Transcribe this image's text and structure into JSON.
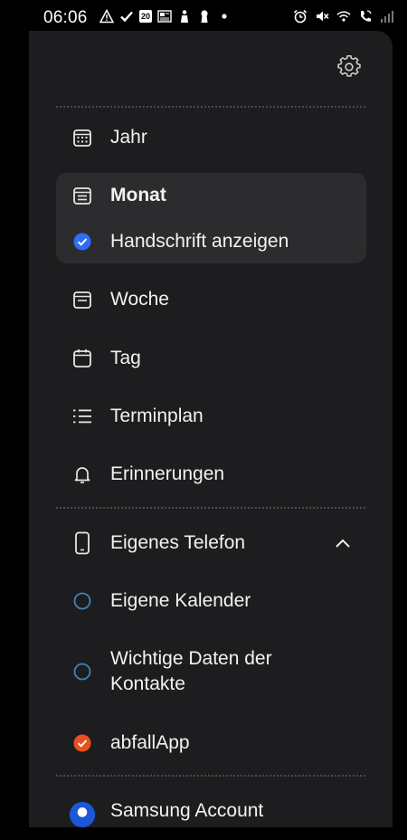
{
  "status_bar": {
    "time": "06:06",
    "left_icons": [
      "warning-icon",
      "check-icon",
      "calendar-20-icon",
      "news-icon",
      "person-icon",
      "keyhole-icon",
      "dot-icon"
    ],
    "right_icons": [
      "alarm-icon",
      "mute-icon",
      "wifi-icon",
      "wifi-call-icon",
      "signal-icon"
    ],
    "calendar_day": "20"
  },
  "drawer": {
    "views": [
      {
        "label": "Jahr",
        "icon": "calendar-grid-icon"
      },
      {
        "label": "Monat",
        "icon": "calendar-month-icon"
      },
      {
        "label": "Woche",
        "icon": "calendar-week-icon"
      },
      {
        "label": "Tag",
        "icon": "calendar-day-icon"
      },
      {
        "label": "Terminplan",
        "icon": "list-icon"
      },
      {
        "label": "Erinnerungen",
        "icon": "bell-icon"
      }
    ],
    "handwriting_option": {
      "label": "Handschrift anzeigen",
      "checked": true
    },
    "accounts": {
      "phone_label": "Eigenes Telefon",
      "expanded": true,
      "calendars": [
        {
          "label": "Eigene Kalender",
          "checked": false,
          "color": "#3a87b8"
        },
        {
          "label": "Wichtige Daten der Kontakte",
          "checked": false,
          "color": "#3a87b8"
        },
        {
          "label": "abfallApp",
          "checked": true,
          "color": "#e8501f"
        }
      ]
    },
    "samsung_account_label": "Samsung Account"
  },
  "colors": {
    "drawer_bg": "#1d1d1f",
    "highlight_bg": "#2c2c2e",
    "accent_blue": "#2f6df5",
    "accent_orange": "#e8501f"
  }
}
